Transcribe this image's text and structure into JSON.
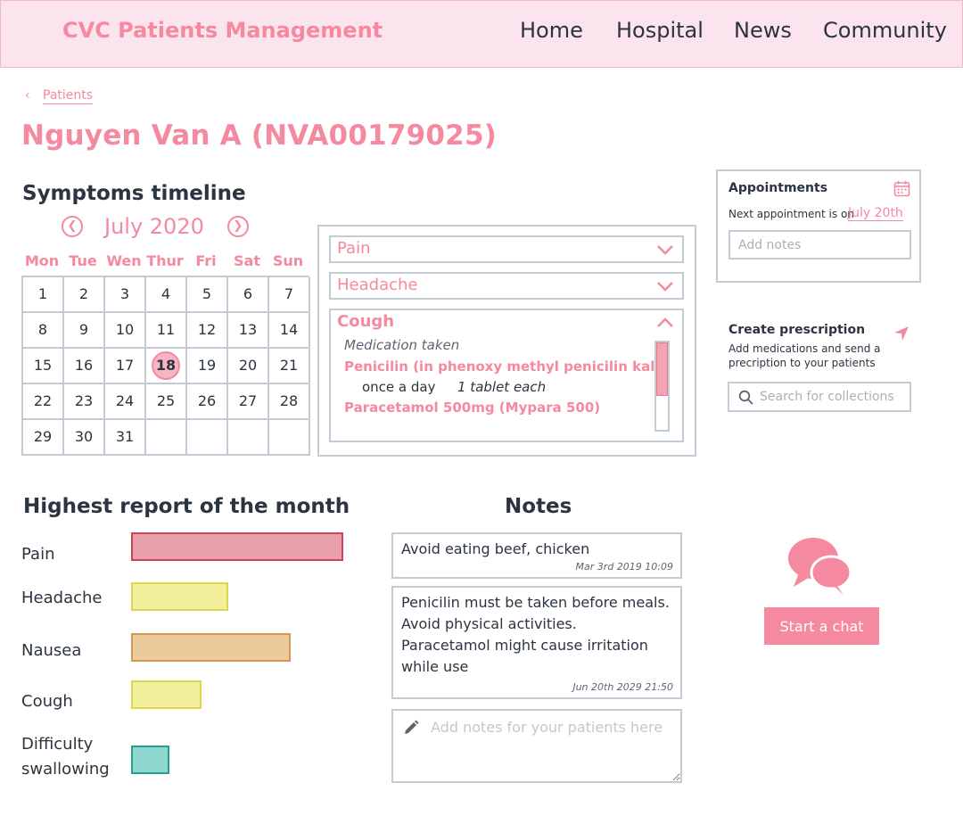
{
  "app": {
    "brand": "CVC Patients Management",
    "nav": [
      {
        "label": "Home"
      },
      {
        "label": "Hospital"
      },
      {
        "label": "News"
      },
      {
        "label": "Community"
      }
    ]
  },
  "breadcrumb": {
    "label": "Patients"
  },
  "patient": {
    "title": "Nguyen Van A (NVA00179025)"
  },
  "symptoms_timeline": {
    "title": "Symptoms timeline",
    "month": "July 2020",
    "prev_icon": "chevron-left-circle-icon",
    "next_icon": "chevron-right-circle-icon",
    "weekdays": [
      "Mon",
      "Tue",
      "Wen",
      "Thur",
      "Fri",
      "Sat",
      "Sun"
    ],
    "days": [
      "1",
      "2",
      "3",
      "4",
      "5",
      "6",
      "7",
      "8",
      "9",
      "10",
      "11",
      "12",
      "13",
      "14",
      "15",
      "16",
      "17",
      "18",
      "19",
      "20",
      "21",
      "22",
      "23",
      "24",
      "25",
      "26",
      "27",
      "28",
      "29",
      "30",
      "31",
      "",
      "",
      "",
      ""
    ],
    "selected_day": "18"
  },
  "symptom_panel": {
    "items": [
      {
        "label": "Pain",
        "expanded": false
      },
      {
        "label": "Headache",
        "expanded": false
      },
      {
        "label": "Cough",
        "expanded": true
      }
    ],
    "cough": {
      "caption": "Medication taken",
      "med1_name": "Penicilin (in phenoxy methyl penicilin kali)",
      "med1_frequency": "once a day",
      "med1_dose": "1 tablet each",
      "med2_name": "Paracetamol 500mg (Mypara 500)"
    }
  },
  "appointments": {
    "title": "Appointments",
    "next_text": "Next appointment is on",
    "next_date": "July 20th",
    "notes_placeholder": "Add notes",
    "icon": "calendar-icon"
  },
  "prescription": {
    "title": "Create prescription",
    "description": "Add medications and send a precription to your patients",
    "search_placeholder": "Search for collections",
    "send_icon": "send-icon",
    "search_icon": "search-icon"
  },
  "highest_report": {
    "title": "Highest report of the month",
    "items": [
      {
        "label": "Pain",
        "level": 1.0,
        "color": "#e8a0ab",
        "border": "#d44058"
      },
      {
        "label": "Headache",
        "level": 0.46,
        "color": "#f2f09a",
        "border": "#ddd64a"
      },
      {
        "label": "Nausea",
        "level": 0.75,
        "color": "#ebcb9c",
        "border": "#d19a50"
      },
      {
        "label": "Cough",
        "level": 0.33,
        "color": "#f2f09a",
        "border": "#ddd64a"
      },
      {
        "label_line1": "Difficulty",
        "label_line2": "swallowing",
        "level": 0.18,
        "color": "#8fd8cf",
        "border": "#2a9d8f"
      }
    ]
  },
  "notes": {
    "title": "Notes",
    "items": [
      {
        "text": "Avoid eating beef, chicken",
        "time": "Mar 3rd 2019   10:09"
      },
      {
        "line1": "Penicilin must be taken before meals.",
        "line2": "Avoid physical activities.",
        "line3": "Paracetamol might cause irritation",
        "line4": "while use",
        "time": "Jun 20th 2029   21:50"
      }
    ],
    "input_placeholder": "Add notes for your patients here",
    "input_icon": "pencil-icon"
  },
  "chat": {
    "button_label": "Start a chat",
    "icon": "chat-bubbles-icon",
    "accent": "#f4899f"
  }
}
